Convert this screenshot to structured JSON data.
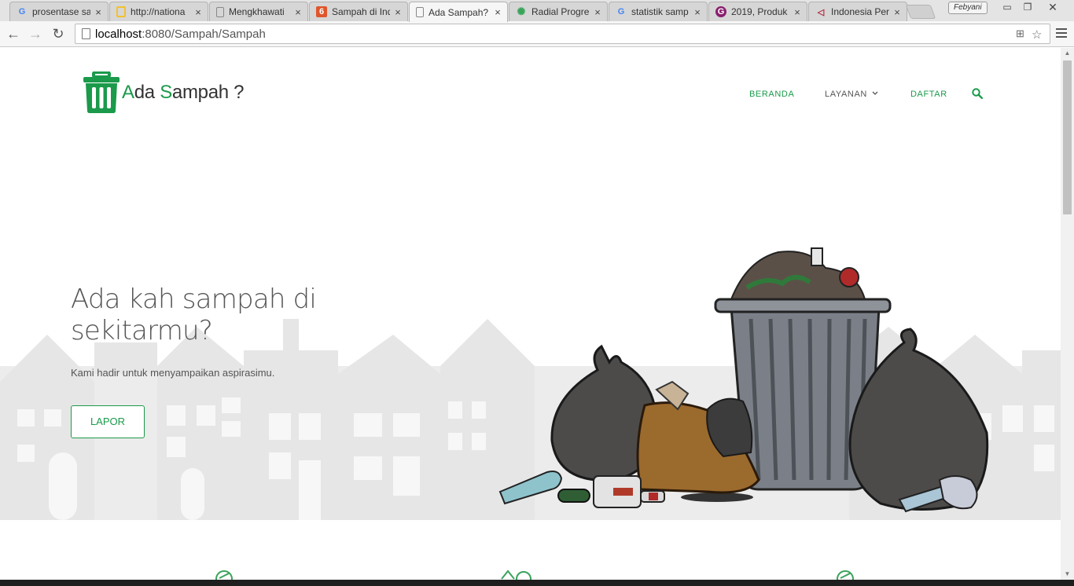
{
  "browser": {
    "tabs": [
      {
        "title": "prosentase sa",
        "icon": "google-icon",
        "color": "#4285f4"
      },
      {
        "title": "http://nationa",
        "icon": "page-yellow-icon",
        "color": "#f2c12e"
      },
      {
        "title": "Mengkhawati",
        "icon": "document-icon",
        "color": "#888888"
      },
      {
        "title": "Sampah di Ind",
        "icon": "flame-icon",
        "color": "#e0562b"
      },
      {
        "title": "Ada Sampah?",
        "icon": "document-icon",
        "color": "#888888",
        "active": true
      },
      {
        "title": "Radial Progre",
        "icon": "gear-icon",
        "color": "#3aa35a"
      },
      {
        "title": "statistik samp",
        "icon": "google-icon",
        "color": "#4285f4"
      },
      {
        "title": "2019, Produk",
        "icon": "g-purple-icon",
        "color": "#8a1f6e"
      },
      {
        "title": "Indonesia Per",
        "icon": "triangle-icon",
        "color": "#b3203a"
      }
    ],
    "close_glyph": "×",
    "profile_name": "Febyani",
    "url_host": "localhost",
    "url_path": ":8080/Sampah/Sampah"
  },
  "site": {
    "logo_parts": [
      "A",
      "da ",
      "S",
      "ampah ?"
    ],
    "nav": {
      "beranda": "BERANDA",
      "layanan": "LAYANAN",
      "daftar": "DAFTAR"
    },
    "hero": {
      "title": "Ada kah sampah di sekitarmu?",
      "subtitle": "Kami hadir untuk menyampaikan aspirasimu.",
      "cta": "LAPOR"
    }
  },
  "colors": {
    "brand_green": "#1a9a4a",
    "hero_bg": "#efefef",
    "skyline": "#e4e4e4"
  }
}
